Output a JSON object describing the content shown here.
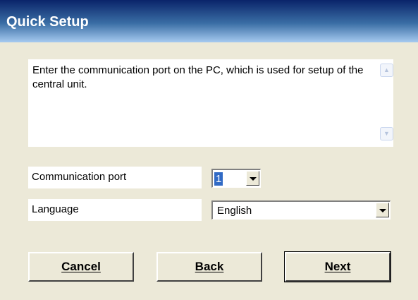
{
  "window": {
    "title": "Quick Setup"
  },
  "description": {
    "text": "Enter the communication port on the PC, which is used for setup of the central unit.",
    "scroll_up_icon": "chevron-up-icon",
    "scroll_down_icon": "chevron-down-icon"
  },
  "fields": {
    "port_label": "Communication port",
    "port_value": "1",
    "language_label": "Language",
    "language_value": "English"
  },
  "buttons": {
    "cancel": "Cancel",
    "back": "Back",
    "next": "Next"
  }
}
